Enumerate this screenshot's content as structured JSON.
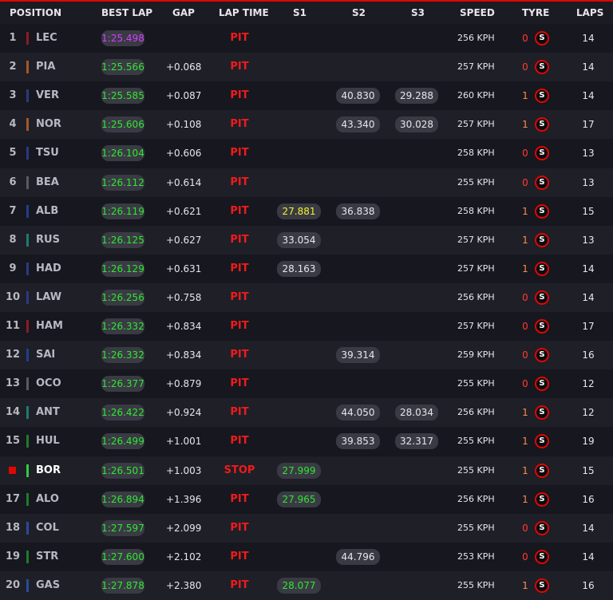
{
  "headers": {
    "position": "POSITION",
    "best_lap": "BEST LAP",
    "gap": "GAP",
    "lap_time": "LAP TIME",
    "s1": "S1",
    "s2": "S2",
    "s3": "S3",
    "speed": "SPEED",
    "tyre": "TYRE",
    "laps": "LAPS"
  },
  "colors": {
    "accent": "#e10600",
    "best_lap_green": "#2ee82e",
    "fastest_purple": "#d040ff",
    "personal_best_yellow": "#f3f32a"
  },
  "tyre_icon": "soft-tyre-icon",
  "rows": [
    {
      "pos": "1",
      "code": "LEC",
      "team_color": "#8b1c24",
      "best": "1:25.498",
      "best_fastest": true,
      "gap": "",
      "status": "PIT",
      "s1": "",
      "s2": "",
      "s3": "",
      "speed": "256 KPH",
      "stint": "0",
      "compound": "S",
      "laps": "14"
    },
    {
      "pos": "2",
      "code": "PIA",
      "team_color": "#a0582a",
      "best": "1:25.566",
      "gap": "+0.068",
      "status": "PIT",
      "s1": "",
      "s2": "",
      "s3": "",
      "speed": "257 KPH",
      "stint": "0",
      "compound": "S",
      "laps": "14"
    },
    {
      "pos": "3",
      "code": "VER",
      "team_color": "#2a3a80",
      "best": "1:25.585",
      "gap": "+0.087",
      "status": "PIT",
      "s1": "",
      "s2": "40.830",
      "s3": "29.288",
      "speed": "260 KPH",
      "stint": "1",
      "compound": "S",
      "laps": "14"
    },
    {
      "pos": "4",
      "code": "NOR",
      "team_color": "#a0582a",
      "best": "1:25.606",
      "gap": "+0.108",
      "status": "PIT",
      "s1": "",
      "s2": "43.340",
      "s3": "30.028",
      "speed": "257 KPH",
      "stint": "1",
      "compound": "S",
      "laps": "17"
    },
    {
      "pos": "5",
      "code": "TSU",
      "team_color": "#2a3a80",
      "best": "1:26.104",
      "gap": "+0.606",
      "status": "PIT",
      "s1": "",
      "s2": "",
      "s3": "",
      "speed": "258 KPH",
      "stint": "0",
      "compound": "S",
      "laps": "13"
    },
    {
      "pos": "6",
      "code": "BEA",
      "team_color": "#5a5a62",
      "best": "1:26.112",
      "gap": "+0.614",
      "status": "PIT",
      "s1": "",
      "s2": "",
      "s3": "",
      "speed": "255 KPH",
      "stint": "0",
      "compound": "S",
      "laps": "13"
    },
    {
      "pos": "7",
      "code": "ALB",
      "team_color": "#1f3f8a",
      "best": "1:26.119",
      "gap": "+0.621",
      "status": "PIT",
      "s1": "27.881",
      "s1_best": "yellow",
      "s2": "36.838",
      "s3": "",
      "speed": "258 KPH",
      "stint": "1",
      "compound": "S",
      "laps": "15"
    },
    {
      "pos": "8",
      "code": "RUS",
      "team_color": "#1e7a70",
      "best": "1:26.125",
      "gap": "+0.627",
      "status": "PIT",
      "s1": "33.054",
      "s2": "",
      "s3": "",
      "speed": "257 KPH",
      "stint": "1",
      "compound": "S",
      "laps": "13"
    },
    {
      "pos": "9",
      "code": "HAD",
      "team_color": "#2a3a80",
      "best": "1:26.129",
      "gap": "+0.631",
      "status": "PIT",
      "s1": "28.163",
      "s2": "",
      "s3": "",
      "speed": "257 KPH",
      "stint": "1",
      "compound": "S",
      "laps": "14"
    },
    {
      "pos": "10",
      "code": "LAW",
      "team_color": "#2a3a80",
      "best": "1:26.256",
      "gap": "+0.758",
      "status": "PIT",
      "s1": "",
      "s2": "",
      "s3": "",
      "speed": "256 KPH",
      "stint": "0",
      "compound": "S",
      "laps": "14"
    },
    {
      "pos": "11",
      "code": "HAM",
      "team_color": "#8b1c24",
      "best": "1:26.332",
      "gap": "+0.834",
      "status": "PIT",
      "s1": "",
      "s2": "",
      "s3": "",
      "speed": "257 KPH",
      "stint": "0",
      "compound": "S",
      "laps": "17"
    },
    {
      "pos": "12",
      "code": "SAI",
      "team_color": "#1f3f8a",
      "best": "1:26.332",
      "gap": "+0.834",
      "status": "PIT",
      "s1": "",
      "s2": "39.314",
      "s3": "",
      "speed": "259 KPH",
      "stint": "0",
      "compound": "S",
      "laps": "16"
    },
    {
      "pos": "13",
      "code": "OCO",
      "team_color": "#5a5a62",
      "best": "1:26.377",
      "gap": "+0.879",
      "status": "PIT",
      "s1": "",
      "s2": "",
      "s3": "",
      "speed": "255 KPH",
      "stint": "0",
      "compound": "S",
      "laps": "12"
    },
    {
      "pos": "14",
      "code": "ANT",
      "team_color": "#1e7a70",
      "best": "1:26.422",
      "gap": "+0.924",
      "status": "PIT",
      "s1": "",
      "s2": "44.050",
      "s3": "28.034",
      "speed": "256 KPH",
      "stint": "1",
      "compound": "S",
      "laps": "12"
    },
    {
      "pos": "15",
      "code": "HUL",
      "team_color": "#1f7a2e",
      "best": "1:26.499",
      "gap": "+1.001",
      "status": "PIT",
      "s1": "",
      "s2": "39.853",
      "s3": "32.317",
      "speed": "255 KPH",
      "stint": "1",
      "compound": "S",
      "laps": "19"
    },
    {
      "pos": "",
      "code": "BOR",
      "team_color": "#2ecc40",
      "stopped": true,
      "best": "1:26.501",
      "gap": "+1.003",
      "status": "STOP",
      "s1": "27.999",
      "s1_best": "green",
      "s2": "",
      "s3": "",
      "speed": "255 KPH",
      "stint": "1",
      "compound": "S",
      "laps": "15"
    },
    {
      "pos": "17",
      "code": "ALO",
      "team_color": "#1f7a2e",
      "best": "1:26.894",
      "gap": "+1.396",
      "status": "PIT",
      "s1": "27.965",
      "s1_best": "green",
      "s2": "",
      "s3": "",
      "speed": "256 KPH",
      "stint": "1",
      "compound": "S",
      "laps": "16"
    },
    {
      "pos": "18",
      "code": "COL",
      "team_color": "#2a4a9a",
      "best": "1:27.597",
      "gap": "+2.099",
      "status": "PIT",
      "s1": "",
      "s2": "",
      "s3": "",
      "speed": "255 KPH",
      "stint": "0",
      "compound": "S",
      "laps": "14"
    },
    {
      "pos": "19",
      "code": "STR",
      "team_color": "#1f7a2e",
      "best": "1:27.600",
      "gap": "+2.102",
      "status": "PIT",
      "s1": "",
      "s2": "44.796",
      "s3": "",
      "speed": "253 KPH",
      "stint": "0",
      "compound": "S",
      "laps": "14"
    },
    {
      "pos": "20",
      "code": "GAS",
      "team_color": "#2a4a9a",
      "best": "1:27.878",
      "gap": "+2.380",
      "status": "PIT",
      "s1": "28.077",
      "s1_best": "green",
      "s2": "",
      "s3": "",
      "speed": "255 KPH",
      "stint": "1",
      "compound": "S",
      "laps": "16"
    }
  ]
}
